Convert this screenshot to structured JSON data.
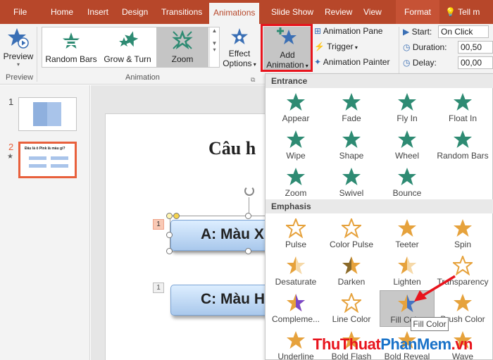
{
  "tabs": {
    "file": "File",
    "home": "Home",
    "insert": "Insert",
    "design": "Design",
    "transitions": "Transitions",
    "animations": "Animations",
    "slide_show": "Slide Show",
    "review": "Review",
    "view": "View",
    "format": "Format",
    "tell_me": "Tell m"
  },
  "ribbon": {
    "preview": {
      "label": "Preview",
      "group": "Preview"
    },
    "gallery": {
      "items": [
        "Random Bars",
        "Grow & Turn",
        "Zoom"
      ],
      "selected": "Zoom",
      "group": "Animation"
    },
    "effect_options": {
      "line1": "Effect",
      "line2": "Options"
    },
    "add_animation": {
      "line1": "Add",
      "line2": "Animation"
    },
    "advanced": {
      "pane": "Animation Pane",
      "trigger": "Trigger",
      "painter": "Animation Painter"
    },
    "timing": {
      "start_label": "Start:",
      "start_value": "On Click",
      "duration_label": "Duration:",
      "duration_value": "00,50",
      "delay_label": "Delay:",
      "delay_value": "00,00"
    }
  },
  "thumbnails": {
    "slide1_num": "1",
    "slide2_num": "2",
    "slide2_title": "Đâu là ô Pink là màu gì?"
  },
  "slide": {
    "title": "Câu h",
    "answer_a": "A: Màu X",
    "answer_c": "C: Màu H",
    "tag1": "1",
    "tag2": "1"
  },
  "panel": {
    "entrance_header": "Entrance",
    "entrance": [
      "Appear",
      "Fade",
      "Fly In",
      "Float In",
      "Wipe",
      "Shape",
      "Wheel",
      "Random Bars",
      "Zoom",
      "Swivel",
      "Bounce"
    ],
    "emphasis_header": "Emphasis",
    "emphasis": [
      "Pulse",
      "Color Pulse",
      "Teeter",
      "Spin",
      "Desaturate",
      "Darken",
      "Lighten",
      "Transparency",
      "Compleme...",
      "Line Color",
      "Fill Color",
      "Brush Color",
      "Underline",
      "Bold Flash",
      "Bold Reveal",
      "Wave"
    ],
    "tooltip": "Fill Color"
  },
  "watermark": {
    "part1": "ThuThuat",
    "part2": "PhanMem",
    "part3": ".vn"
  },
  "colors": {
    "accent": "#b7472a",
    "entrance_star": "#2e8b73",
    "emphasis_star": "#e6a23c",
    "highlight": "#e8141d"
  }
}
